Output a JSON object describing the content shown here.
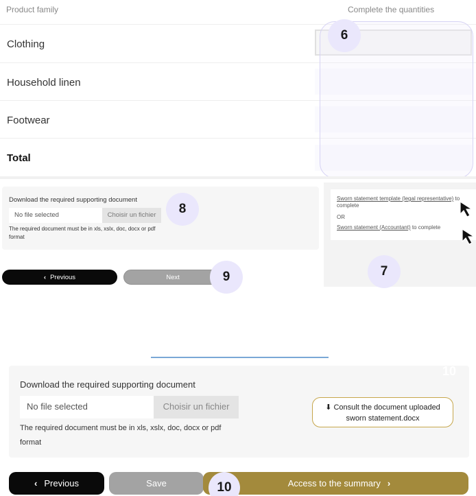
{
  "table": {
    "col_product_family": "Product family",
    "col_quantities": "Complete the quantities",
    "rows": [
      {
        "label": "Clothing"
      },
      {
        "label": "Household linen"
      },
      {
        "label": "Footwear"
      },
      {
        "label": "Total"
      }
    ]
  },
  "badges": {
    "b6": "6",
    "b7": "7",
    "b8": "8",
    "b9": "9",
    "b10": "10",
    "b10_faint": "10"
  },
  "upload_small": {
    "title": "Download the required supporting document",
    "file_placeholder": "No file selected",
    "choose_label": "Choisir un fichier",
    "help": "The required document must be in xls, xslx, doc, docx or pdf format"
  },
  "sworn": {
    "link1": "Sworn statement template (legal representative)",
    "link1_suffix": " to complete",
    "or": "OR",
    "link2": "Sworn statement (Accountant)",
    "link2_suffix": " to complete"
  },
  "nav_small": {
    "previous": "Previous",
    "next": "Next"
  },
  "upload_big": {
    "title": "Download the required supporting document",
    "file_placeholder": "No file selected",
    "choose_label": "Choisir un fichier",
    "help": "The required document must be in xls, xslx, doc, docx or pdf format",
    "consult_label": "Consult the document uploaded",
    "consult_file": "sworn statement.docx"
  },
  "nav_big": {
    "previous": "Previous",
    "save": "Save",
    "summary": "Access to the summary"
  },
  "icons": {
    "chevron_left": "‹",
    "chevron_right": "›",
    "download": "⬇"
  },
  "colors": {
    "accent_gold": "#a38a3c",
    "badge_bg": "#eae7fc",
    "highlight_outline": "#d6d2f4"
  }
}
